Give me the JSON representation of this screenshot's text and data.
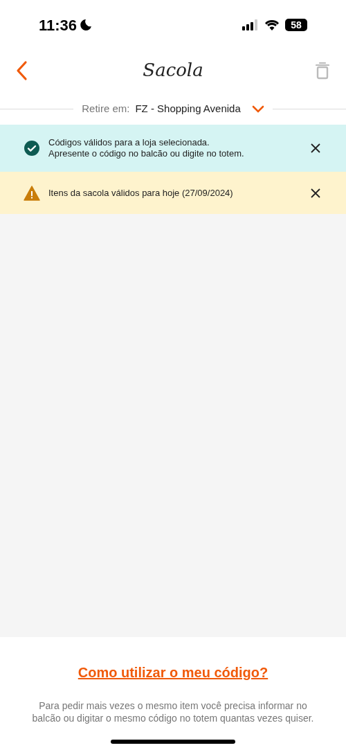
{
  "status_bar": {
    "time": "11:36",
    "battery": "58"
  },
  "header": {
    "title": "Sacola"
  },
  "store_picker": {
    "label": "Retire em:",
    "value": "FZ - Shopping Avenida"
  },
  "alerts": [
    {
      "kind": "success",
      "lines": [
        "Códigos válidos para a loja selecionada.",
        "Apresente o código no balcão ou digite no totem."
      ]
    },
    {
      "kind": "warning",
      "lines": [
        "Itens da sacola válidos para hoje (27/09/2024)"
      ]
    }
  ],
  "footer": {
    "link": "Como utilizar o meu código?",
    "note": "Para pedir mais vezes o mesmo item você precisa informar no balcão ou digitar o mesmo código no totem quantas vezes quiser."
  }
}
